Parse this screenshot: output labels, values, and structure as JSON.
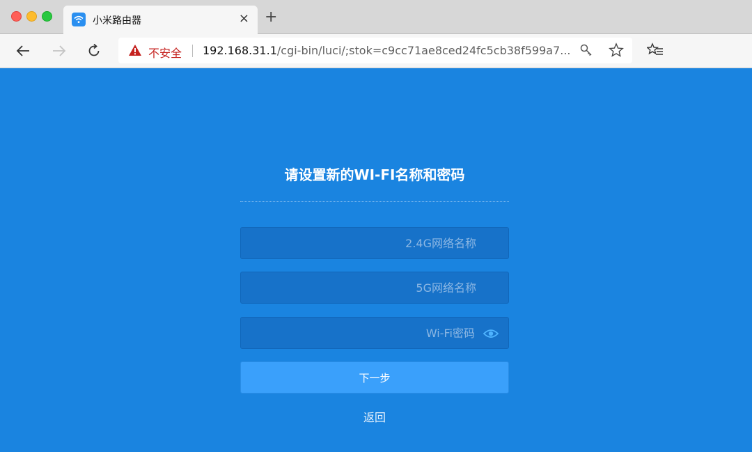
{
  "browser": {
    "tab": {
      "title": "小米路由器",
      "close": "×",
      "favicon": "wifi-icon"
    },
    "new_tab_label": "+",
    "omnibox": {
      "security_label": "不安全",
      "url_host": "192.168.31.1",
      "url_path": "/cgi-bin/luci/;stok=c9cc71ae8ced24fc5cb38f599a7..."
    },
    "icons": [
      "back-arrow-icon",
      "forward-arrow-icon",
      "reload-icon",
      "warning-icon",
      "key-icon",
      "star-icon",
      "favorites-list-icon"
    ]
  },
  "setup": {
    "heading": "请设置新的WI-FI名称和密码",
    "fields": [
      {
        "placeholder": "2.4G网络名称",
        "value": ""
      },
      {
        "placeholder": "5G网络名称",
        "value": ""
      },
      {
        "placeholder": "Wi-Fi密码",
        "value": ""
      }
    ],
    "next_label": "下一步",
    "back_label": "返回"
  },
  "colors": {
    "page_bg": "#1a84e0",
    "field_bg": "#1772c9",
    "button_bg": "#3aa0fb",
    "insecure_red": "#c5221f"
  }
}
